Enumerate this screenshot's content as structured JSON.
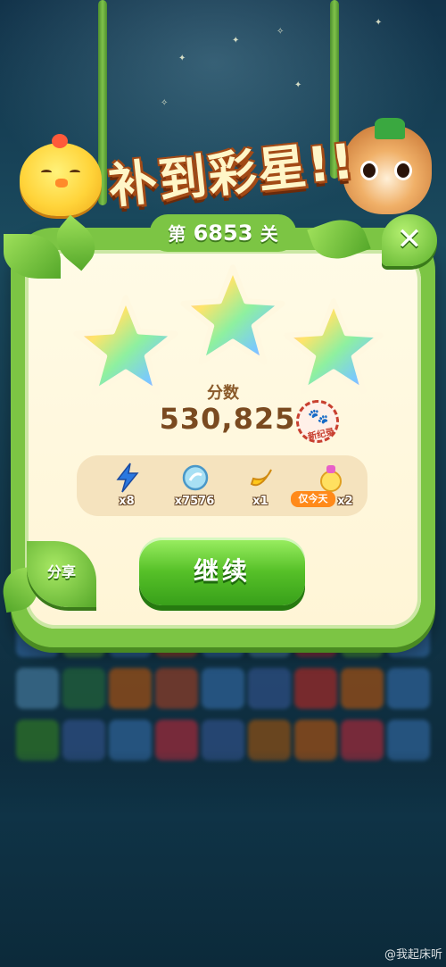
{
  "banner": {
    "title": "补到彩星!!"
  },
  "level": {
    "prefix": "第",
    "number": "6853",
    "suffix": "关"
  },
  "stars_earned": 3,
  "stars_total": 3,
  "score": {
    "label": "分数",
    "value": "530,825",
    "record_badge": "新纪录",
    "record_icon": "paw-icon"
  },
  "rewards": [
    {
      "icon": "lightning-icon",
      "count": "x8",
      "color": "#2a78e0"
    },
    {
      "icon": "coin-icon",
      "count": "x7576",
      "color": "#7ac8e8"
    },
    {
      "icon": "banana-icon",
      "count": "x1",
      "color": "#ffc81a"
    },
    {
      "icon": "potion-icon",
      "count": "x2",
      "color": "#e860c8",
      "tag": "仅今天"
    }
  ],
  "buttons": {
    "share": "分享",
    "continue": "继续",
    "close": "✕"
  },
  "watermark": "@我起床听"
}
